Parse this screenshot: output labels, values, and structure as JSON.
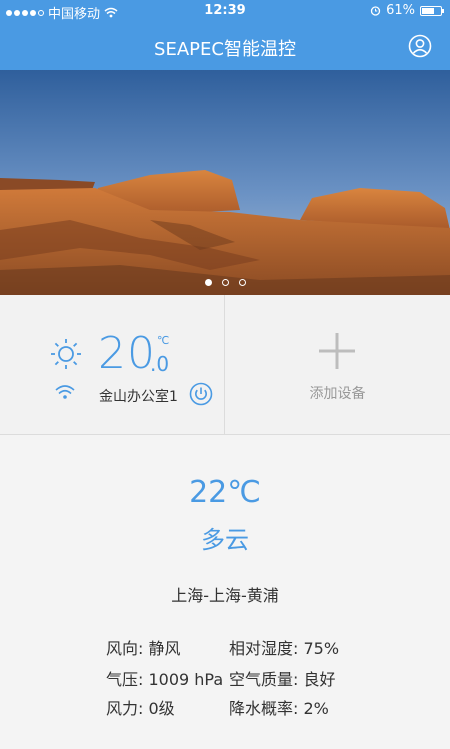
{
  "statusbar": {
    "carrier": "中国移动",
    "time": "12:39",
    "battery": "61%"
  },
  "navbar": {
    "title": "SEAPEC智能温控"
  },
  "banner": {
    "pages": 3,
    "active_page": 1
  },
  "device": {
    "temp_int": "20",
    "temp_dec": ".0",
    "unit": "℃",
    "name": "金山办公室1"
  },
  "add_device": {
    "label": "添加设备"
  },
  "weather": {
    "temperature": "22℃",
    "condition": "多云",
    "location": "上海-上海-黄浦",
    "wind_dir": "风向: 静风",
    "humidity": "相对湿度: 75%",
    "pressure": "气压: 1009 hPa",
    "air_quality": "空气质量: 良好",
    "wind_force": "风力: 0级",
    "rain_prob": "降水概率: 2%"
  },
  "icons": {
    "signal": "signal-dots-icon",
    "wifi": "wifi-icon",
    "alarm": "alarm-icon",
    "battery": "battery-icon",
    "user": "user-icon",
    "sun": "sun-icon",
    "power": "power-icon",
    "plus": "plus-icon"
  },
  "colors": {
    "accent": "#4a9ae3",
    "muted": "#999999"
  }
}
